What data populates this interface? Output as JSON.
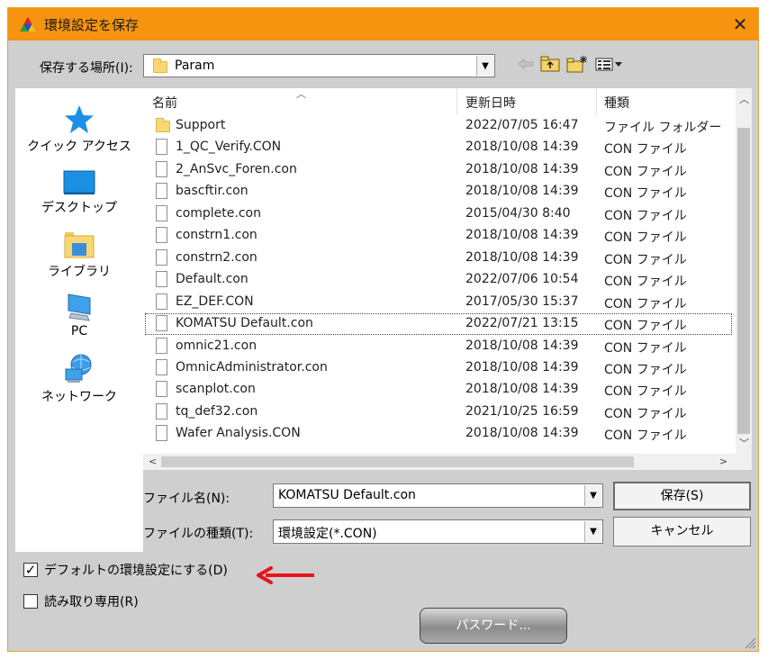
{
  "window": {
    "title": "環境設定を保存",
    "close_glyph": "✕"
  },
  "location": {
    "label": "保存する場所(I):",
    "value": "Param"
  },
  "places": [
    {
      "label": "クイック アクセス",
      "icon": "star-icon"
    },
    {
      "label": "デスクトップ",
      "icon": "desktop-icon"
    },
    {
      "label": "ライブラリ",
      "icon": "library-icon"
    },
    {
      "label": "PC",
      "icon": "pc-icon"
    },
    {
      "label": "ネットワーク",
      "icon": "network-icon"
    }
  ],
  "columns": [
    "名前",
    "更新日時",
    "種類"
  ],
  "files": [
    {
      "name": "Support",
      "date": "2022/07/05 16:47",
      "type": "ファイル フォルダー",
      "kind": "folder"
    },
    {
      "name": "1_QC_Verify.CON",
      "date": "2018/10/08 14:39",
      "type": "CON ファイル",
      "kind": "file"
    },
    {
      "name": "2_AnSvc_Foren.con",
      "date": "2018/10/08 14:39",
      "type": "CON ファイル",
      "kind": "file"
    },
    {
      "name": "bascftir.con",
      "date": "2018/10/08 14:39",
      "type": "CON ファイル",
      "kind": "file"
    },
    {
      "name": "complete.con",
      "date": "2015/04/30 8:40",
      "type": "CON ファイル",
      "kind": "file"
    },
    {
      "name": "constrn1.con",
      "date": "2018/10/08 14:39",
      "type": "CON ファイル",
      "kind": "file"
    },
    {
      "name": "constrn2.con",
      "date": "2018/10/08 14:39",
      "type": "CON ファイル",
      "kind": "file"
    },
    {
      "name": "Default.con",
      "date": "2022/07/06 10:54",
      "type": "CON ファイル",
      "kind": "file"
    },
    {
      "name": "EZ_DEF.CON",
      "date": "2017/05/30 15:37",
      "type": "CON ファイル",
      "kind": "file"
    },
    {
      "name": "KOMATSU Default.con",
      "date": "2022/07/21 13:15",
      "type": "CON ファイル",
      "kind": "file"
    },
    {
      "name": "omnic21.con",
      "date": "2018/10/08 14:39",
      "type": "CON ファイル",
      "kind": "file"
    },
    {
      "name": "OmnicAdministrator.con",
      "date": "2018/10/08 14:39",
      "type": "CON ファイル",
      "kind": "file"
    },
    {
      "name": "scanplot.con",
      "date": "2018/10/08 14:39",
      "type": "CON ファイル",
      "kind": "file"
    },
    {
      "name": "tq_def32.con",
      "date": "2021/10/25 16:59",
      "type": "CON ファイル",
      "kind": "file"
    },
    {
      "name": "Wafer Analysis.CON",
      "date": "2018/10/08 14:39",
      "type": "CON ファイル",
      "kind": "file"
    }
  ],
  "filename": {
    "label": "ファイル名(N):",
    "value": "KOMATSU Default.con"
  },
  "filetype": {
    "label": "ファイルの種類(T):",
    "value": "環境設定(*.CON)"
  },
  "buttons": {
    "save": "保存(S)",
    "cancel": "キャンセル",
    "password": "パスワード..."
  },
  "options": {
    "default_label": "デフォルトの環境設定にする(D)",
    "default_checked": true,
    "readonly_label": "読み取り専用(R)",
    "readonly_checked": false
  },
  "colors": {
    "titlebar": "#f7940f",
    "annotation_arrow": "#e8141c"
  }
}
